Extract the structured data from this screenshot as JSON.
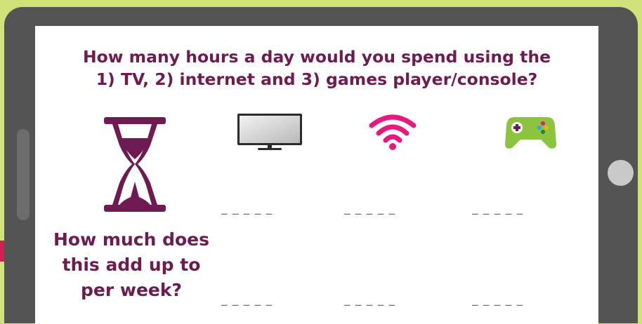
{
  "question": {
    "line1": "How many hours a day would you spend using the",
    "line2": "1) TV, 2) internet and 3) games player/console?"
  },
  "icons": {
    "hourglass": "hourglass-icon",
    "tv": "tv-icon",
    "internet": "wifi-icon",
    "console": "gamepad-icon"
  },
  "daily_blanks": {
    "tv": "_ _ _ _ _",
    "internet": "_ _ _ _ _",
    "console": "_ _ _ _ _"
  },
  "weekly_question": {
    "line1": "How much does",
    "line2": "this add up to",
    "line3": "per week?"
  },
  "weekly_blanks": {
    "tv": "_ _ _ _ _",
    "internet": "_ _ _ _ _",
    "console": "_ _ _ _ _"
  },
  "colors": {
    "background": "#d2e27a",
    "tablet_frame": "#545454",
    "heading_text": "#6e1b51",
    "wifi": "#e5197e",
    "gamepad": "#8cc43f"
  }
}
